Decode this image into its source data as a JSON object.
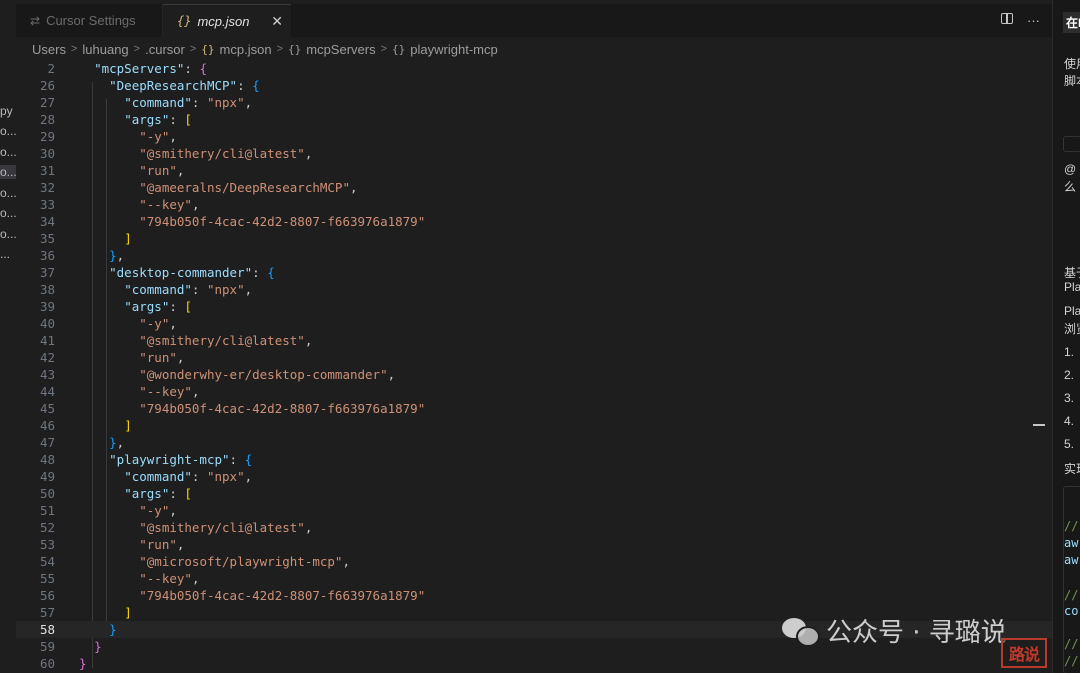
{
  "tabs": [
    {
      "icon": "settings-icon",
      "label": "Cursor Settings",
      "active": false
    },
    {
      "icon": "json-icon",
      "label": "mcp.json",
      "active": true
    }
  ],
  "tab_actions": [
    "split-editor-icon",
    "more-actions-icon"
  ],
  "breadcrumb": [
    "Users",
    "luhuang",
    ".cursor",
    "mcp.json",
    "mcpServers",
    "playwright-mcp"
  ],
  "left_strip": [
    "py",
    "o...",
    "o...",
    "o...",
    "o...",
    "o...",
    "o...",
    "..."
  ],
  "editor": {
    "current_line": "58",
    "lines": [
      {
        "n": "2",
        "code": "  \"mcpServers\": {"
      },
      {
        "n": "26",
        "code": "    \"DeepResearchMCP\": {"
      },
      {
        "n": "27",
        "code": "      \"command\": \"npx\","
      },
      {
        "n": "28",
        "code": "      \"args\": ["
      },
      {
        "n": "29",
        "code": "        \"-y\","
      },
      {
        "n": "30",
        "code": "        \"@smithery/cli@latest\","
      },
      {
        "n": "31",
        "code": "        \"run\","
      },
      {
        "n": "32",
        "code": "        \"@ameeralns/DeepResearchMCP\","
      },
      {
        "n": "33",
        "code": "        \"--key\","
      },
      {
        "n": "34",
        "code": "        \"794b050f-4cac-42d2-8807-f663976a1879\""
      },
      {
        "n": "35",
        "code": "      ]"
      },
      {
        "n": "36",
        "code": "    },"
      },
      {
        "n": "37",
        "code": "    \"desktop-commander\": {"
      },
      {
        "n": "38",
        "code": "      \"command\": \"npx\","
      },
      {
        "n": "39",
        "code": "      \"args\": ["
      },
      {
        "n": "40",
        "code": "        \"-y\","
      },
      {
        "n": "41",
        "code": "        \"@smithery/cli@latest\","
      },
      {
        "n": "42",
        "code": "        \"run\","
      },
      {
        "n": "43",
        "code": "        \"@wonderwhy-er/desktop-commander\","
      },
      {
        "n": "44",
        "code": "        \"--key\","
      },
      {
        "n": "45",
        "code": "        \"794b050f-4cac-42d2-8807-f663976a1879\""
      },
      {
        "n": "46",
        "code": "      ]"
      },
      {
        "n": "47",
        "code": "    },"
      },
      {
        "n": "48",
        "code": "    \"playwright-mcp\": {"
      },
      {
        "n": "49",
        "code": "      \"command\": \"npx\","
      },
      {
        "n": "50",
        "code": "      \"args\": ["
      },
      {
        "n": "51",
        "code": "        \"-y\","
      },
      {
        "n": "52",
        "code": "        \"@smithery/cli@latest\","
      },
      {
        "n": "53",
        "code": "        \"run\","
      },
      {
        "n": "54",
        "code": "        \"@microsoft/playwright-mcp\","
      },
      {
        "n": "55",
        "code": "        \"--key\","
      },
      {
        "n": "56",
        "code": "        \"794b050f-4cac-42d2-8807-f663976a1879\""
      },
      {
        "n": "57",
        "code": "      ]"
      },
      {
        "n": "58",
        "code": "    }"
      },
      {
        "n": "59",
        "code": "  }"
      },
      {
        "n": "60",
        "code": "}"
      }
    ]
  },
  "right_panel": {
    "header": "在M",
    "fragments": [
      "使用",
      "脚本",
      "@",
      "么",
      "基于",
      "Pla",
      "Pla",
      "浏览",
      "1.",
      "2.",
      "3.",
      "4.",
      "5.",
      "实现",
      "//",
      "aw",
      "aw",
      "//",
      "co",
      "//",
      "//"
    ]
  },
  "watermark": {
    "text": "公众号 · 寻璐说",
    "stamp": "路说"
  },
  "colors": {
    "key": "#9cdcfe",
    "string": "#ce9178",
    "bracket_level1": "#da70d6",
    "bracket_level2": "#179fff",
    "bracket_level3": "#ffd700"
  }
}
